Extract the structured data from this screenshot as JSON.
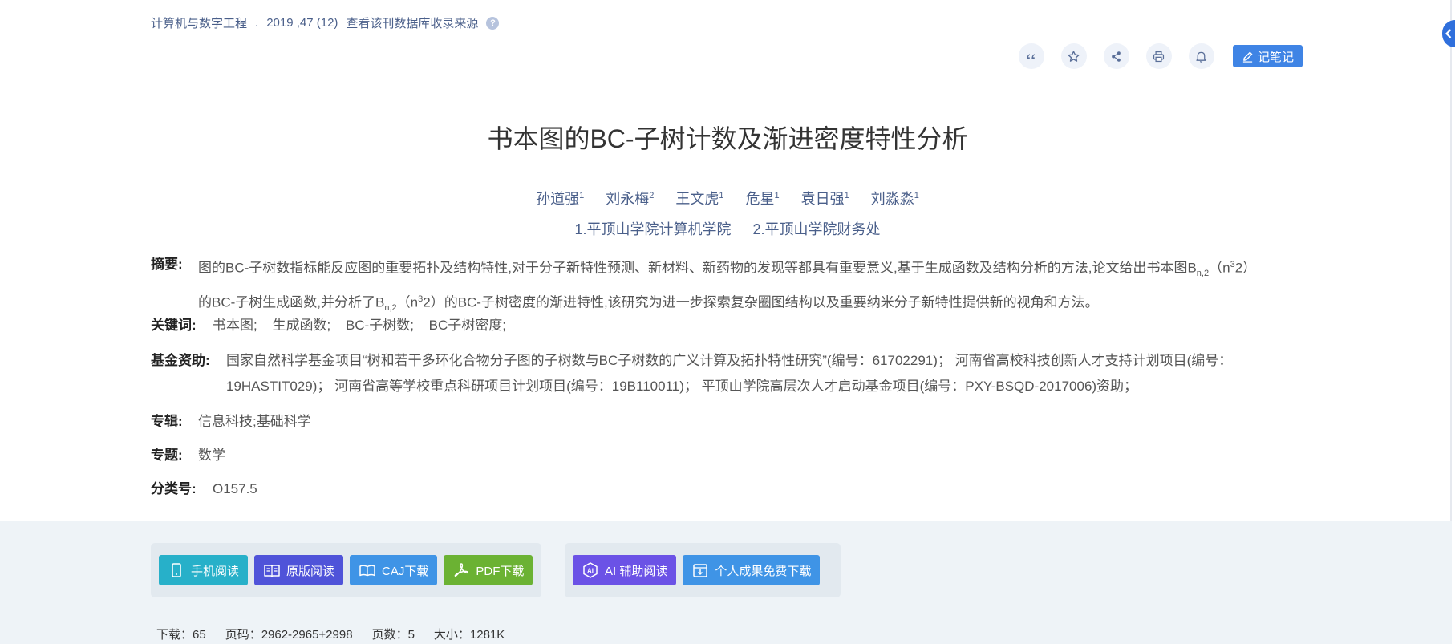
{
  "source": {
    "journal": "计算机与数字工程",
    "issue": "2019 ,47 (12)",
    "db_link": "查看该刊数据库收录来源",
    "help": "?"
  },
  "toolbar": {
    "note_label": "记笔记"
  },
  "article": {
    "title": "书本图的BC-子树计数及渐进密度特性分析",
    "authors": [
      {
        "name": "孙道强",
        "aff": "1"
      },
      {
        "name": "刘永梅",
        "aff": "2"
      },
      {
        "name": "王文虎",
        "aff": "1"
      },
      {
        "name": "危星",
        "aff": "1"
      },
      {
        "name": "袁日强",
        "aff": "1"
      },
      {
        "name": "刘淼淼",
        "aff": "1"
      }
    ],
    "orgs": [
      "1.平顶山学院计算机学院",
      "2.平顶山学院财务处"
    ]
  },
  "abstract": {
    "label": "摘要:",
    "text_1": "图的BC-子树数指标能反应图的重要拓扑及结构特性,对于分子新特性预测、新材料、新药物的发现等都具有重要意义,基于生成函数及结构分析的方法,论文给出书本图B",
    "sub": "n,2",
    "text_2": "（n",
    "sup": "3",
    "text_3": "2）",
    "text_4": "的BC-子树生成函数,并分析了B",
    "sub_2": "n,2",
    "text_5": "（n",
    "sup_2": "3",
    "text_6": "2）的BC-子树密度的渐进特性,该研究为进一步探索复杂圈图结构以及重要纳米分子新特性提供新的视角和方法。"
  },
  "keywords": {
    "label": "关键词:",
    "items": [
      "书本图;",
      "生成函数;",
      "BC-子树数;",
      "BC子树密度;"
    ]
  },
  "funding": {
    "label": "基金资助:",
    "text_1": "国家自然科学基金项目“树和若干多环化合物分子图的子树数与BC子树数的广义计算及拓扑特性研究”(编号：61702291)； 河南省高校科技创新人才支持计划项目(编号：",
    "text_2": "19HASTIT029)； 河南省高等学校重点科研项目计划项目(编号：19B110011)； 平顶山学院高层次人才启动基金项目(编号：PXY-BSQD-2017006)资助；"
  },
  "series": {
    "label": "专辑:",
    "value": "信息科技;基础科学"
  },
  "topic": {
    "label": "专题:",
    "value": "数学"
  },
  "classification": {
    "label": "分类号:",
    "value": "O157.5"
  },
  "buttons": {
    "mobile": "手机阅读",
    "original": "原版阅读",
    "caj": "CAJ下载",
    "pdf": "PDF下载",
    "ai": "AI 辅助阅读",
    "personal": "个人成果免费下载"
  },
  "colors": {
    "mobile": "#27b0c9",
    "original": "#4f53d9",
    "caj": "#3f94e6",
    "pdf": "#6bb233",
    "ai": "#6b52e6",
    "personal": "#3f94e6"
  },
  "stats": {
    "downloads": "下载：65",
    "pages_code": "页码：2962-2965+2998",
    "page_count": "页数：5",
    "size": "大小：1281K"
  }
}
